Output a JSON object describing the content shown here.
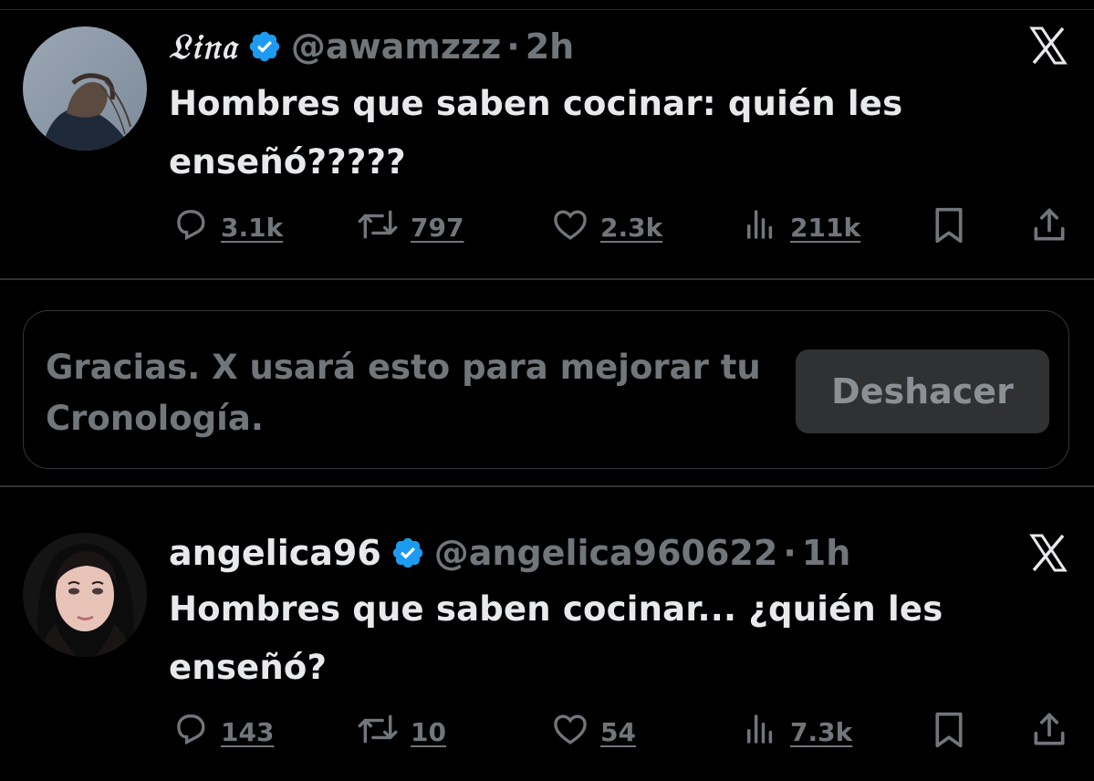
{
  "tweets": [
    {
      "name": "𝔏𝔦𝔫𝔞",
      "handle": "@awamzzz",
      "separator": "·",
      "time": "2h",
      "text": "Hombres que saben cocinar: quién les enseñó?????",
      "stats": {
        "replies": "3.1k",
        "reposts": "797",
        "likes": "2.3k",
        "views": "211k"
      }
    },
    {
      "name": "angelica96",
      "handle": "@angelica960622",
      "separator": "·",
      "time": "1h",
      "text": "Hombres que saben cocinar... ¿quién les enseñó?",
      "stats": {
        "replies": "143",
        "reposts": "10",
        "likes": "54",
        "views": "7.3k"
      }
    }
  ],
  "notice": {
    "message": "Gracias. X usará esto para mejorar tu Cronología.",
    "undo_label": "Deshacer"
  },
  "colors": {
    "background": "#000000",
    "text": "#e7e9ea",
    "secondary": "#71767b",
    "verified": "#1d9bf0"
  },
  "icons": [
    "verified-badge-icon",
    "close-x-icon",
    "reply-icon",
    "repost-icon",
    "like-icon",
    "views-icon",
    "bookmark-icon",
    "share-icon"
  ]
}
